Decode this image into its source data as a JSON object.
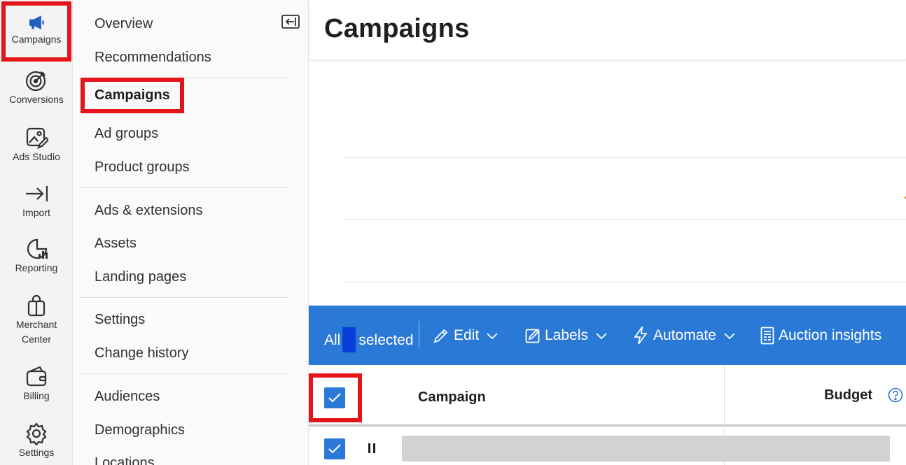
{
  "rail": {
    "items": [
      {
        "label": "Campaigns",
        "icon": "megaphone-icon"
      },
      {
        "label": "Conversions",
        "icon": "target-icon"
      },
      {
        "label": "Ads Studio",
        "icon": "image-edit-icon"
      },
      {
        "label": "Import",
        "icon": "import-arrow-icon"
      },
      {
        "label": "Reporting",
        "icon": "pie-chart-icon"
      },
      {
        "label": "Merchant\nCenter",
        "icon": "shopping-bag-icon"
      },
      {
        "label": "Billing",
        "icon": "wallet-icon"
      },
      {
        "label": "Settings",
        "icon": "gear-icon"
      }
    ]
  },
  "nav": {
    "items": [
      {
        "label": "Overview"
      },
      {
        "label": "Recommendations"
      },
      {
        "label": "Campaigns"
      },
      {
        "label": "Ad groups"
      },
      {
        "label": "Product groups"
      },
      {
        "label": "Ads & extensions"
      },
      {
        "label": "Assets"
      },
      {
        "label": "Landing pages"
      },
      {
        "label": "Settings"
      },
      {
        "label": "Change history"
      },
      {
        "label": "Audiences"
      },
      {
        "label": "Demographics"
      },
      {
        "label": "Locations"
      }
    ]
  },
  "page": {
    "title": "Campaigns"
  },
  "toolbar": {
    "selection_prefix": "All",
    "selection_suffix": "selected",
    "edit_label": "Edit",
    "labels_label": "Labels",
    "automate_label": "Automate",
    "auction_label": "Auction insights"
  },
  "table": {
    "columns": {
      "campaign": "Campaign",
      "budget": "Budget"
    }
  },
  "colors": {
    "accent": "#2a79d7",
    "highlight": "#e3151a",
    "rail_bg": "#f3f3f3"
  }
}
